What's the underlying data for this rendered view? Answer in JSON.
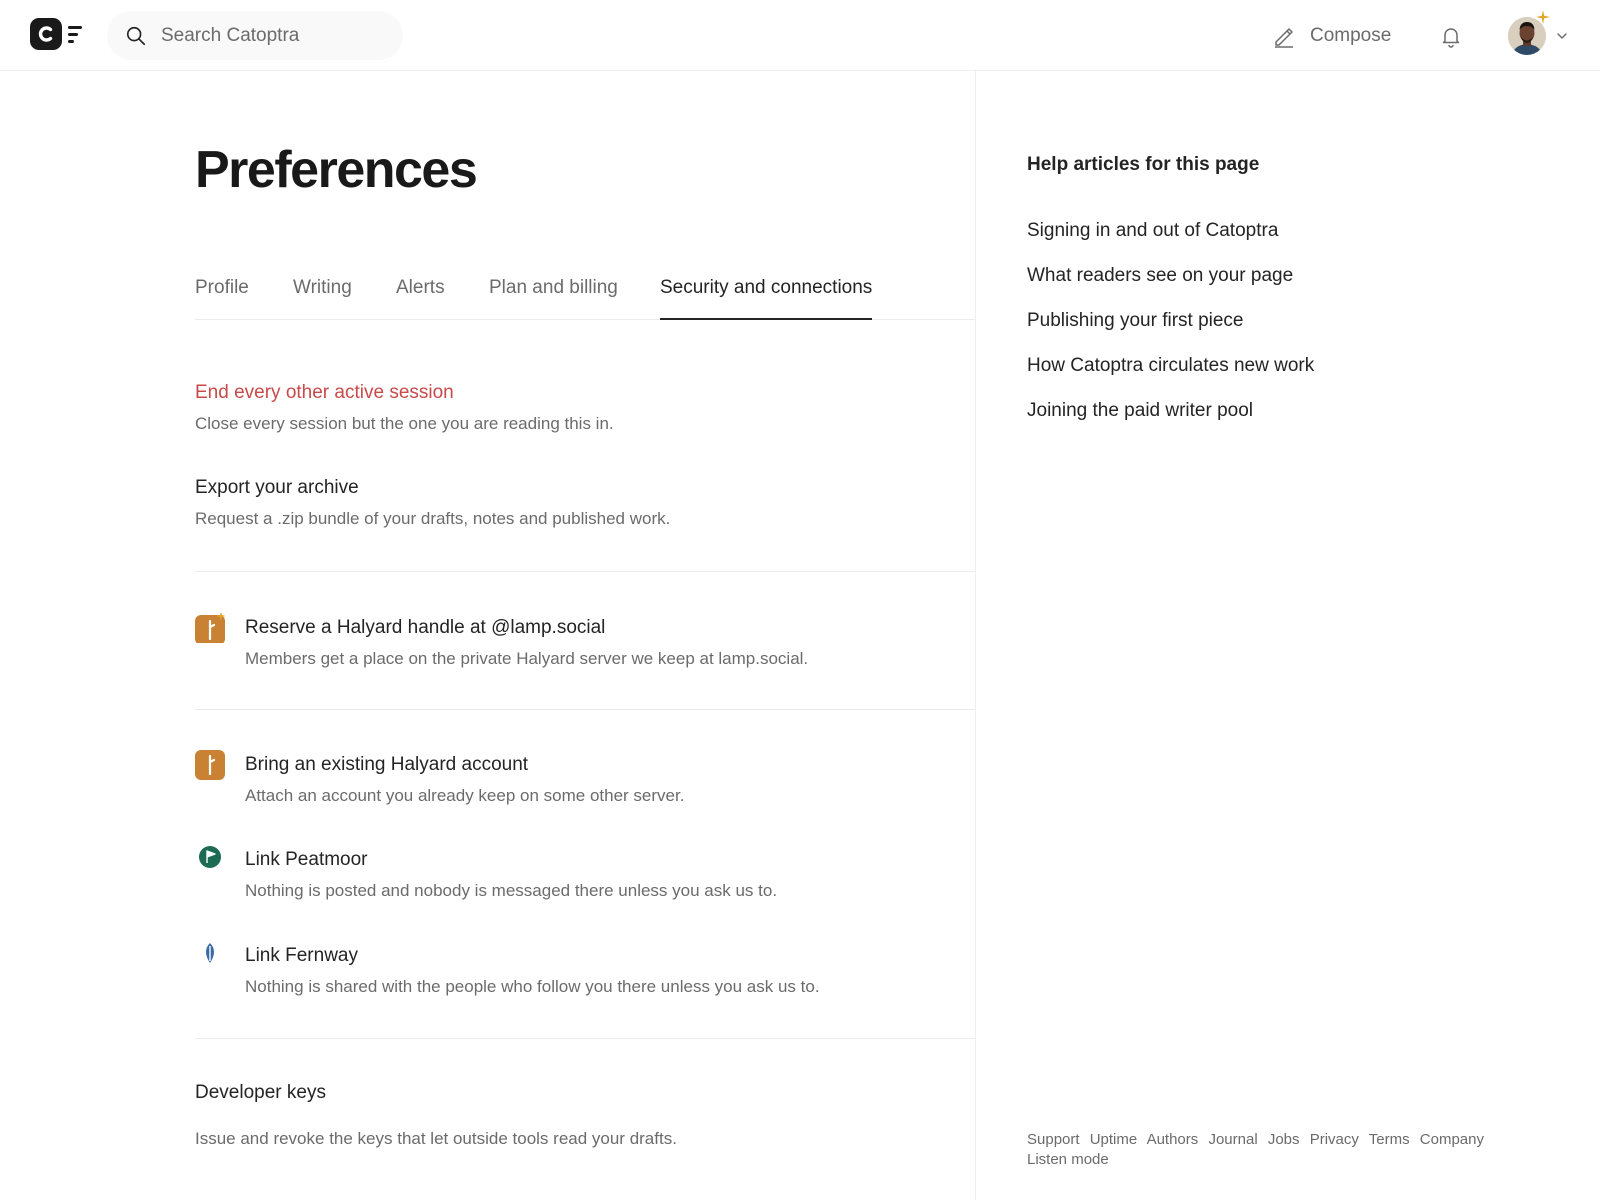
{
  "app": {
    "name": "Catoptra"
  },
  "search": {
    "placeholder": "Search Catoptra",
    "icon": "search-icon"
  },
  "header": {
    "compose_label": "Compose",
    "compose_icon": "pencil-icon",
    "notifications_icon": "bell-icon",
    "account_menu_icon": "chevron-down-icon"
  },
  "page": {
    "title": "Preferences"
  },
  "tabs": [
    {
      "label": "Profile"
    },
    {
      "label": "Writing"
    },
    {
      "label": "Alerts"
    },
    {
      "label": "Plan and billing"
    },
    {
      "label": "Security and connections",
      "active": true
    }
  ],
  "security": {
    "end_sessions": {
      "title": "End every other active session",
      "description": "Close every session but the one you are reading this in."
    },
    "export_archive": {
      "title": "Export your archive",
      "description": "Request a .zip bundle of your drafts, notes and published work."
    }
  },
  "connections": {
    "reserve_halyard": {
      "title": "Reserve a Halyard handle at @lamp.social",
      "description": "Members get a place on the private Halyard server we keep at lamp.social.",
      "icon": "halyard-icon"
    },
    "existing_halyard": {
      "title": "Bring an existing Halyard account",
      "description": "Attach an account you already keep on some other server.",
      "icon": "halyard-icon"
    },
    "peatmoor": {
      "title": "Link Peatmoor",
      "description": "Nothing is posted and nobody is messaged there unless you ask us to.",
      "icon": "peatmoor-icon"
    },
    "fernway": {
      "title": "Link Fernway",
      "description": "Nothing is shared with the people who follow you there unless you ask us to.",
      "icon": "fernway-icon"
    }
  },
  "developer": {
    "title": "Developer keys",
    "description": "Issue and revoke the keys that let outside tools read your drafts."
  },
  "help": {
    "heading": "Help articles for this page",
    "articles": [
      "Signing in and out of Catoptra",
      "What readers see on your page",
      "Publishing your first piece",
      "How Catoptra circulates new work",
      "Joining the paid writer pool"
    ]
  },
  "footer": {
    "links": [
      "Support",
      "Uptime",
      "Authors",
      "Journal",
      "Jobs",
      "Privacy",
      "Terms",
      "Company",
      "Listen mode"
    ]
  },
  "colors": {
    "danger": "#c94a4a",
    "halyard": "#c98233",
    "peatmoor": "#1e6b54",
    "fernway": "#3a6aa8",
    "star": "#e0a52a"
  }
}
